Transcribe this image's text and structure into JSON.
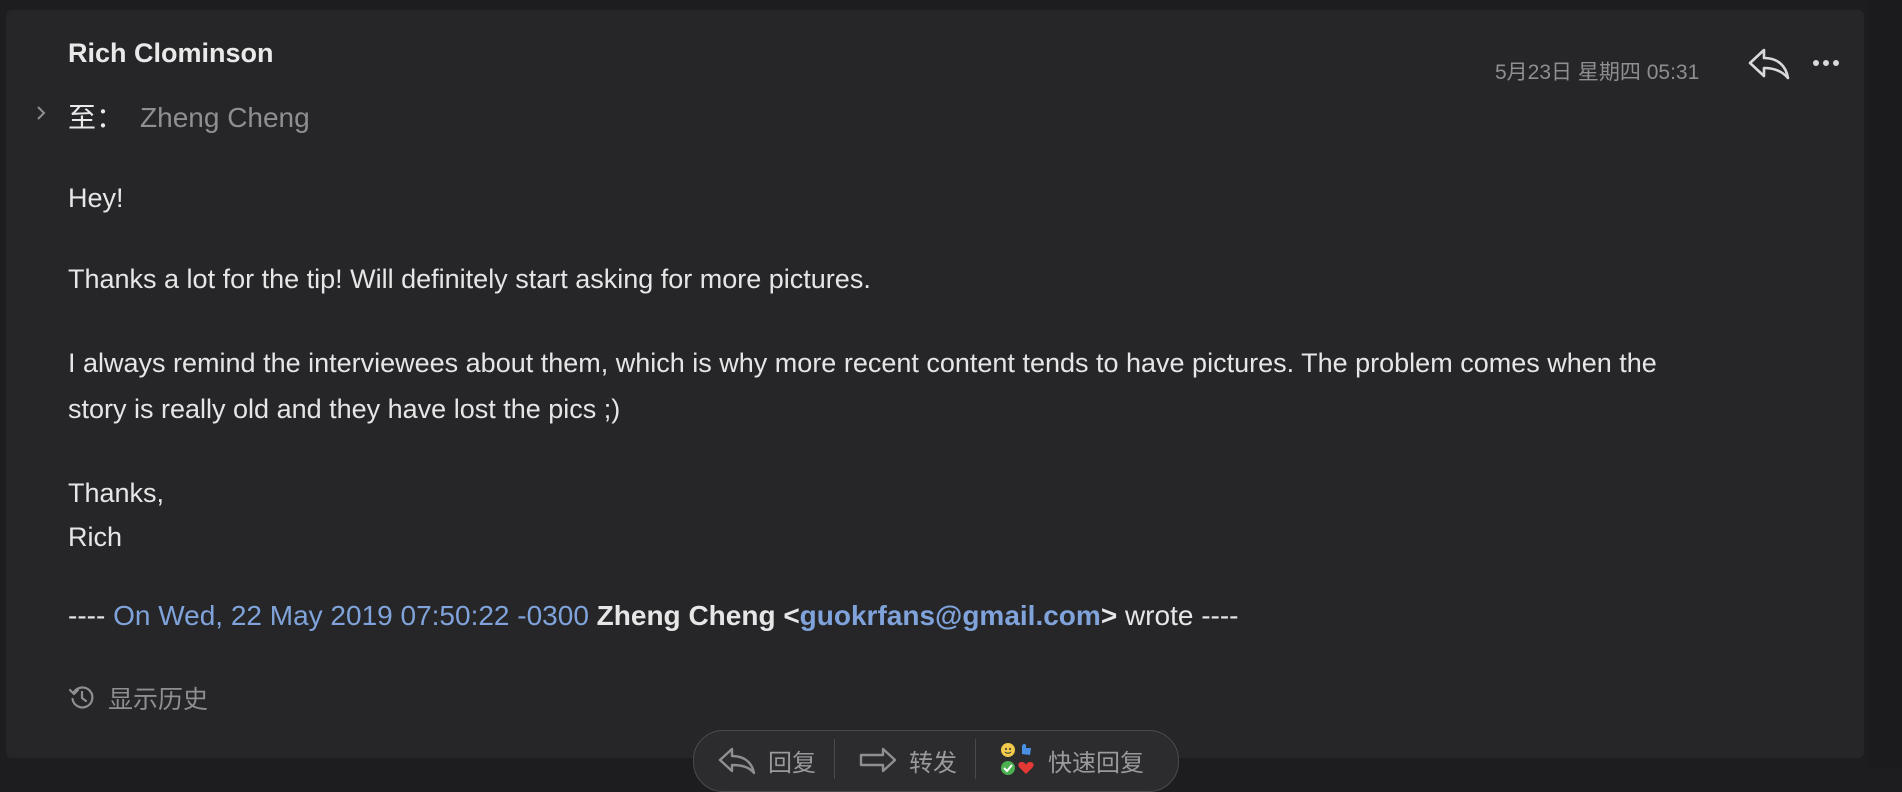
{
  "email": {
    "sender": "Rich Clominson",
    "date": "5月23日 星期四 05:31",
    "to_label": "至：",
    "to_name": "Zheng Cheng",
    "body": {
      "greeting": "Hey!",
      "para1": "Thanks a lot for the tip! Will definitely start asking for more pictures.",
      "para2_line1": "I always remind the interviewees about them, which is why more recent content tends to have pictures. The problem comes when the",
      "para2_line2": "story is really old and they have lost the pics ;)",
      "signoff": "Thanks,",
      "signature": "Rich"
    },
    "quote": {
      "prefix": "----",
      "date_text": "On Wed, 22 May 2019 07:50:22 -0300",
      "author": "Zheng Cheng <",
      "email": "guokrfans@gmail.com",
      "author_close": ">",
      "suffix": "wrote ----"
    },
    "history_label": "显示历史"
  },
  "actions": {
    "reply": "回复",
    "forward": "转发",
    "quick_reply": "快速回复"
  }
}
